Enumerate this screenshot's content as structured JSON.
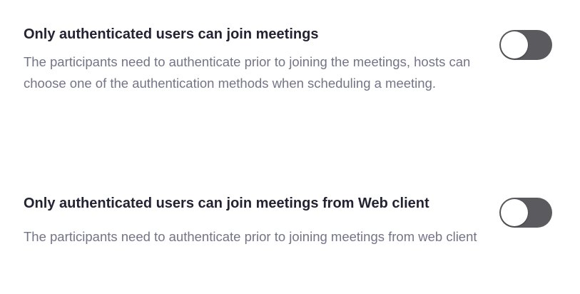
{
  "settings": [
    {
      "title": "Only authenticated users can join meetings",
      "description": "The participants need to authenticate prior to joining the meetings, hosts can choose one of the authentication methods when scheduling a meeting.",
      "enabled": false
    },
    {
      "title": "Only authenticated users can join meetings from Web client",
      "description": "The participants need to authenticate prior to joining meetings from web client",
      "enabled": false
    }
  ],
  "colors": {
    "toggle_off": "#5a5a5f",
    "title_text": "#232333",
    "description_text": "#747487"
  }
}
